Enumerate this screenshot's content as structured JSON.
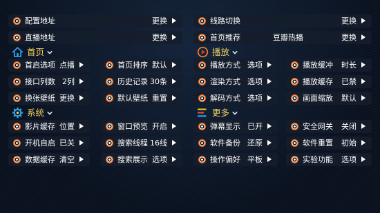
{
  "top_rows": [
    {
      "label": "配置地址",
      "value": "更换"
    },
    {
      "label": "线路切换",
      "value": "更换"
    },
    {
      "label": "直播地址",
      "value": "更换"
    },
    {
      "label": "首页推荐",
      "value": "豆瓣热播",
      "value2": "更换"
    }
  ],
  "sections": {
    "home": {
      "label": "首页",
      "icon": "home-icon"
    },
    "playback": {
      "label": "播放",
      "icon": "play-icon"
    },
    "system": {
      "label": "系统",
      "icon": "gear-icon"
    },
    "more": {
      "label": "更多",
      "icon": "menu-lines-icon"
    }
  },
  "home_items": [
    {
      "label": "首启选项",
      "value": "点播"
    },
    {
      "label": "首页排序",
      "value": "默认"
    },
    {
      "label": "接口列数",
      "value": "2列"
    },
    {
      "label": "历史记录",
      "value": "30条"
    },
    {
      "label": "换张壁纸",
      "value": "更换"
    },
    {
      "label": "默认壁纸",
      "value": "重置"
    }
  ],
  "playback_items": [
    {
      "label": "播放方式",
      "value": "选项"
    },
    {
      "label": "播放缓冲",
      "value": "时长"
    },
    {
      "label": "渲染方式",
      "value": "选项"
    },
    {
      "label": "播放缓存",
      "value": "已禁"
    },
    {
      "label": "解码方式",
      "value": "选项"
    },
    {
      "label": "画面缩放",
      "value": "默认"
    }
  ],
  "system_items": [
    {
      "label": "影片缓存",
      "value": "位置"
    },
    {
      "label": "窗口预览",
      "value": "开启"
    },
    {
      "label": "开机自启",
      "value": "已关"
    },
    {
      "label": "搜索线程",
      "value": "16线"
    },
    {
      "label": "数据缓存",
      "value": "清空"
    },
    {
      "label": "搜索展示",
      "value": "选项"
    }
  ],
  "more_items": [
    {
      "label": "弹幕显示",
      "value": "已开"
    },
    {
      "label": "安全网关",
      "value": "关闭"
    },
    {
      "label": "软件备份",
      "value": "还原"
    },
    {
      "label": "软件重置",
      "value": "初始"
    },
    {
      "label": "操作偏好",
      "value": "平板"
    },
    {
      "label": "实验功能",
      "value": "选项"
    }
  ],
  "colors": {
    "accent_orange": "#f26a1a",
    "section_gold": "#f0d060",
    "home_icon_blue": "#2aa0e8",
    "play_icon_orange": "#f08020",
    "gear_icon_blue": "#2aa0e8",
    "more_icon_multi": "#e06030"
  }
}
